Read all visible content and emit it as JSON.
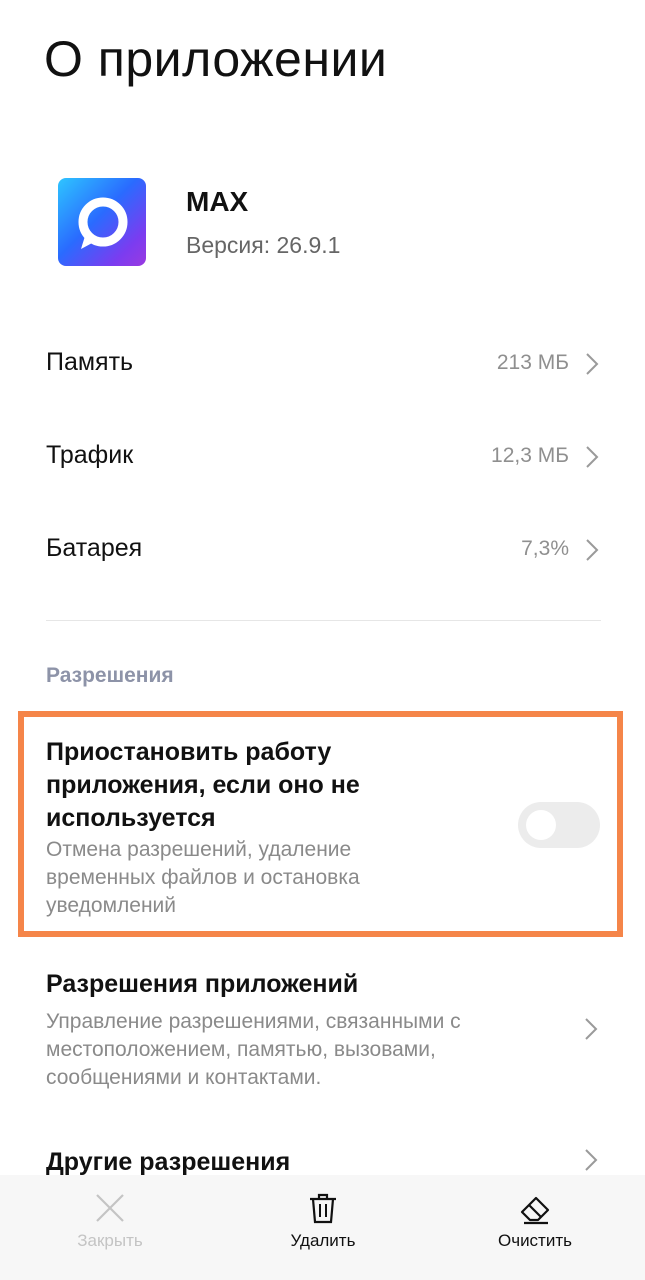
{
  "page": {
    "title": "О приложении"
  },
  "app": {
    "name": "MAX",
    "version": "Версия: 26.9.1"
  },
  "info_rows": [
    {
      "label": "Память",
      "value": "213 МБ"
    },
    {
      "label": "Трафик",
      "value": "12,3 МБ"
    },
    {
      "label": "Батарея",
      "value": "7,3%"
    }
  ],
  "permissions_section": {
    "header": "Разрешения",
    "pause_setting": {
      "title": "Приостановить работу приложения, если оно не используется",
      "description": "Отмена разрешений, удаление временных файлов и остановка уведомлений",
      "enabled": false
    },
    "app_permissions": {
      "title": "Разрешения приложений",
      "description": "Управление разрешениями, связанными с местоположением, памятью, вызовами, сообщениями и контактами."
    },
    "other_permissions": {
      "title": "Другие разрешения"
    }
  },
  "bottom_bar": {
    "close": {
      "label": "Закрыть",
      "icon": "close-icon",
      "disabled": true
    },
    "delete": {
      "label": "Удалить",
      "icon": "trash-icon"
    },
    "clear": {
      "label": "Очистить",
      "icon": "eraser-icon"
    }
  },
  "colors": {
    "highlight": "#f58549",
    "section_header": "#8d93a8"
  }
}
